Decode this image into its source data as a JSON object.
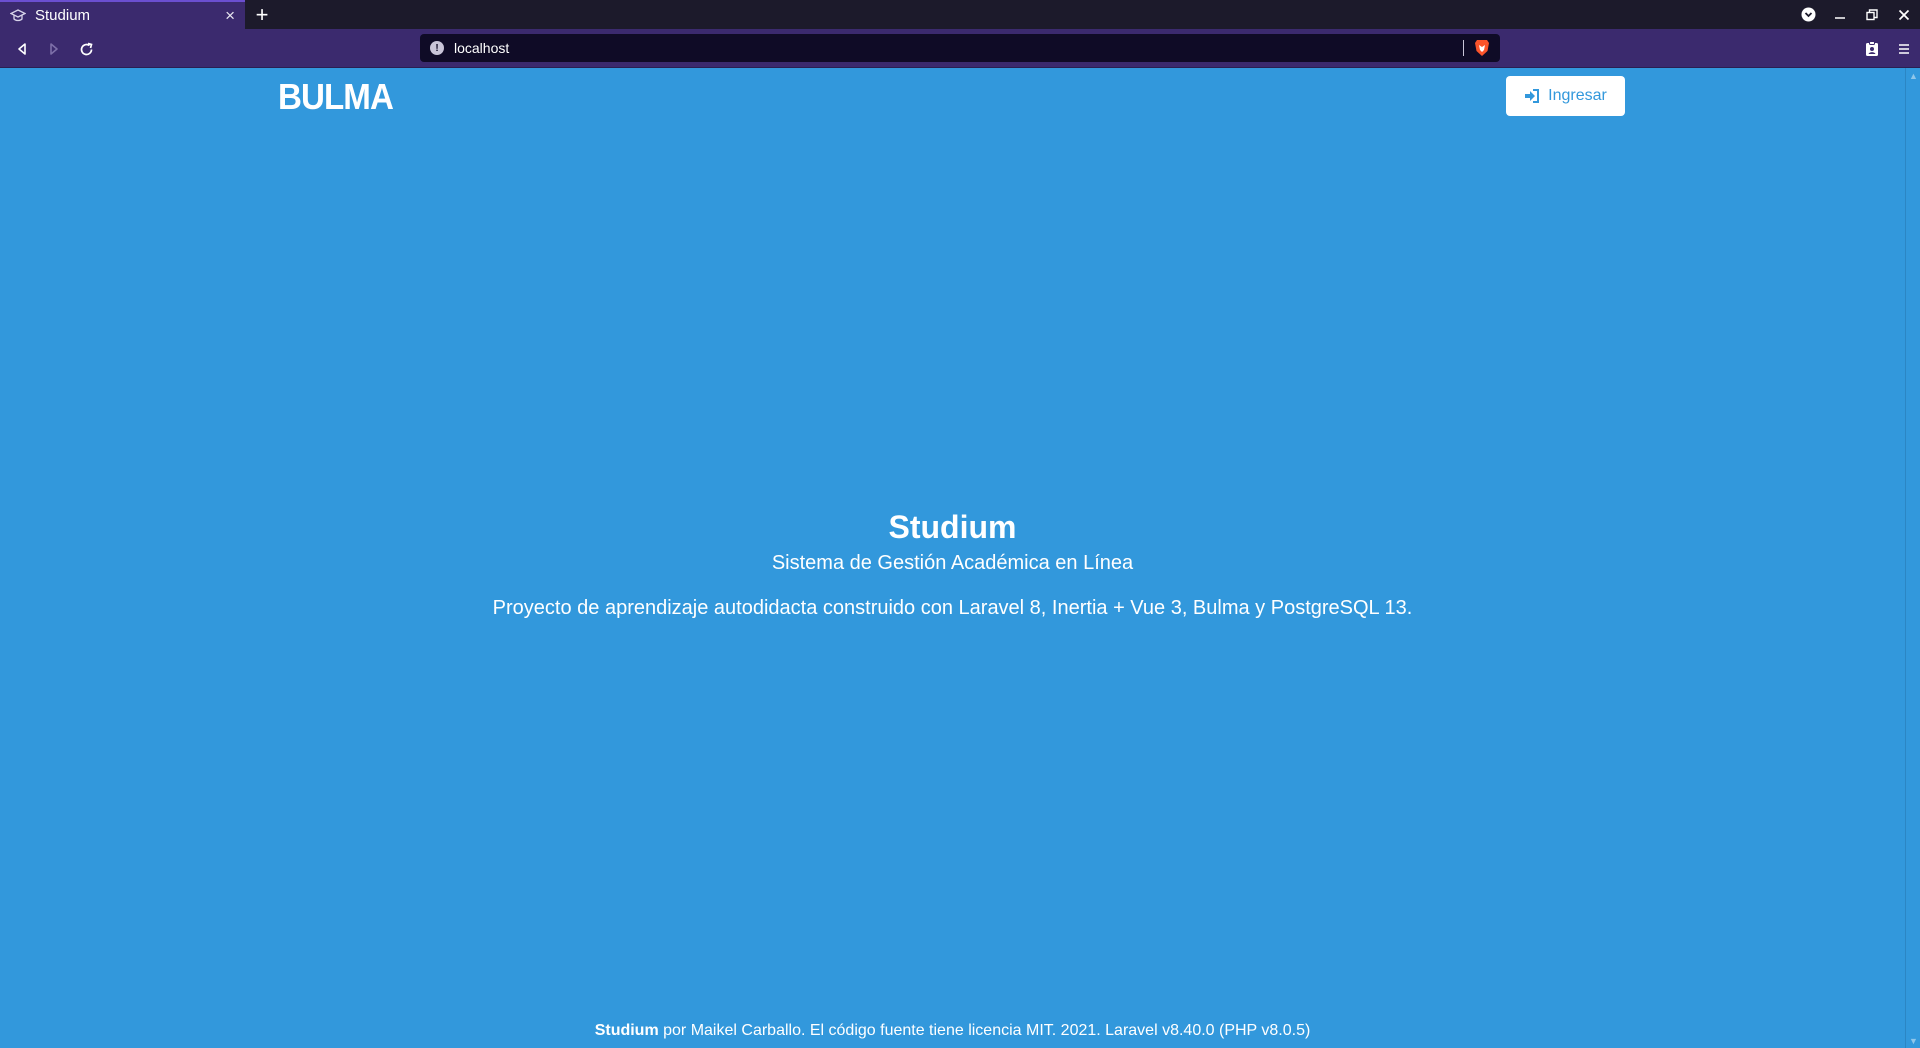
{
  "browser": {
    "tab_title": "Studium",
    "tab_close": "×",
    "new_tab": "+",
    "url": "localhost"
  },
  "navbar": {
    "logo": "BULMA",
    "login_label": "Ingresar"
  },
  "hero": {
    "title": "Studium",
    "subtitle": "Sistema de Gestión Académica en Línea",
    "description": "Proyecto de aprendizaje autodidacta construido con Laravel 8, Inertia + Vue 3, Bulma y PostgreSQL 13."
  },
  "footer": {
    "brand": "Studium",
    "text": " por Maikel Carballo. El código fuente tiene licencia MIT. 2021. Laravel v8.40.0 (PHP v8.0.5)"
  },
  "colors": {
    "page_background": "#3298dc",
    "browser_chrome": "#3b2a6e",
    "url_bar": "#0f0b26"
  }
}
